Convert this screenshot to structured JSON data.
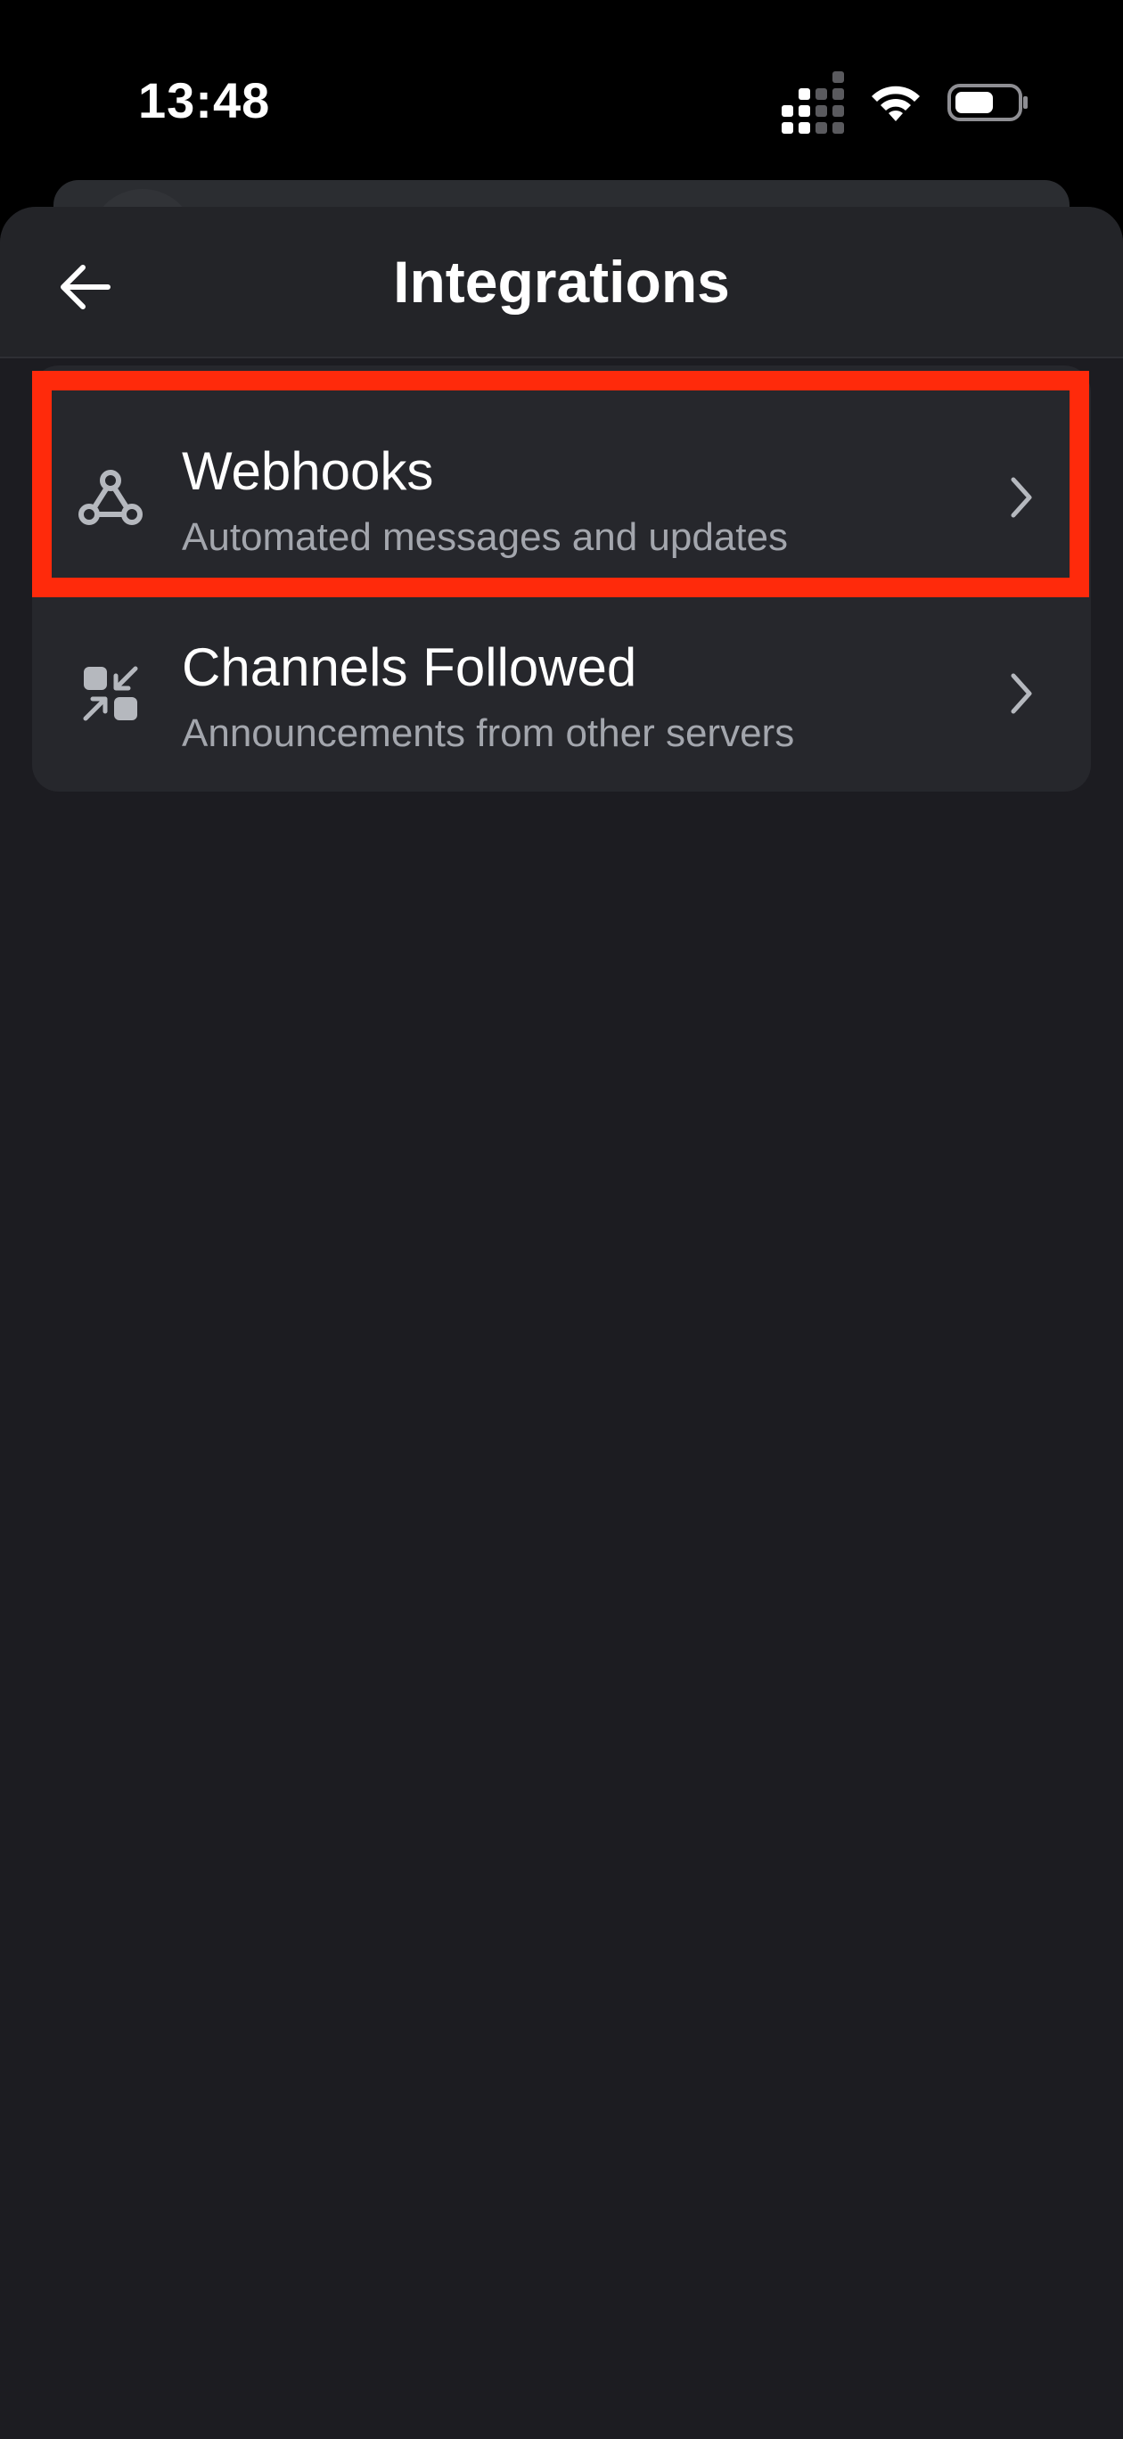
{
  "status_bar": {
    "time": "13:48",
    "icons": [
      "signal-icon",
      "wifi-icon",
      "battery-icon"
    ]
  },
  "header": {
    "title": "Integrations",
    "back_icon": "arrow-left-icon"
  },
  "list": {
    "items": [
      {
        "title": "Webhooks",
        "subtitle": "Automated messages and updates",
        "icon": "webhook-icon",
        "highlighted": true
      },
      {
        "title": "Channels Followed",
        "subtitle": "Announcements from other servers",
        "icon": "channels-followed-icon",
        "highlighted": false
      }
    ]
  },
  "colors": {
    "background": "#1c1c21",
    "header": "#232428",
    "card": "#26272c",
    "highlight": "#ff2a0b",
    "subtitle": "#a3a6ad"
  }
}
